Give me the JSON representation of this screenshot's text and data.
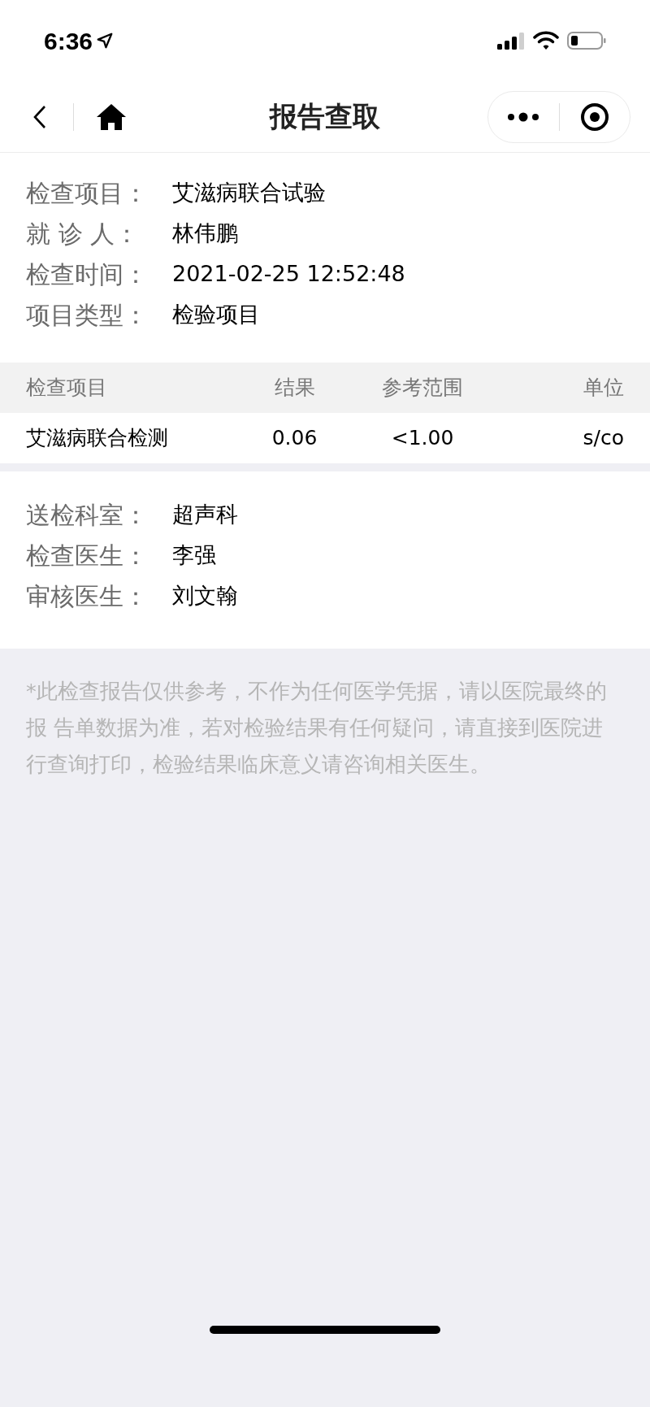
{
  "status_bar": {
    "time": "6:36"
  },
  "nav_bar": {
    "title": "报告查取"
  },
  "report_info": [
    {
      "label": "检查项目：",
      "value": "艾滋病联合试验"
    },
    {
      "label": "就 诊 人：",
      "value": "林伟鹏"
    },
    {
      "label": "检查时间：",
      "value": "2021-02-25 12:52:48"
    },
    {
      "label": "项目类型：",
      "value": "检验项目"
    }
  ],
  "table": {
    "columns": [
      "检查项目",
      "结果",
      "参考范围",
      "单位"
    ],
    "rows": [
      [
        "艾滋病联合检测",
        "0.06",
        "<1.00",
        "s/co"
      ]
    ]
  },
  "exam_info": [
    {
      "label": "送检科室：",
      "value": "超声科"
    },
    {
      "label": "检查医生：",
      "value": "李强"
    },
    {
      "label": "审核医生：",
      "value": "刘文翰"
    }
  ],
  "disclaimer": "*此检查报告仅供参考，不作为任何医学凭据，请以医院最终的报 告单数据为准，若对检验结果有任何疑问，请直接到医院进行查询打印，检验结果临床意义请咨询相关医生。"
}
